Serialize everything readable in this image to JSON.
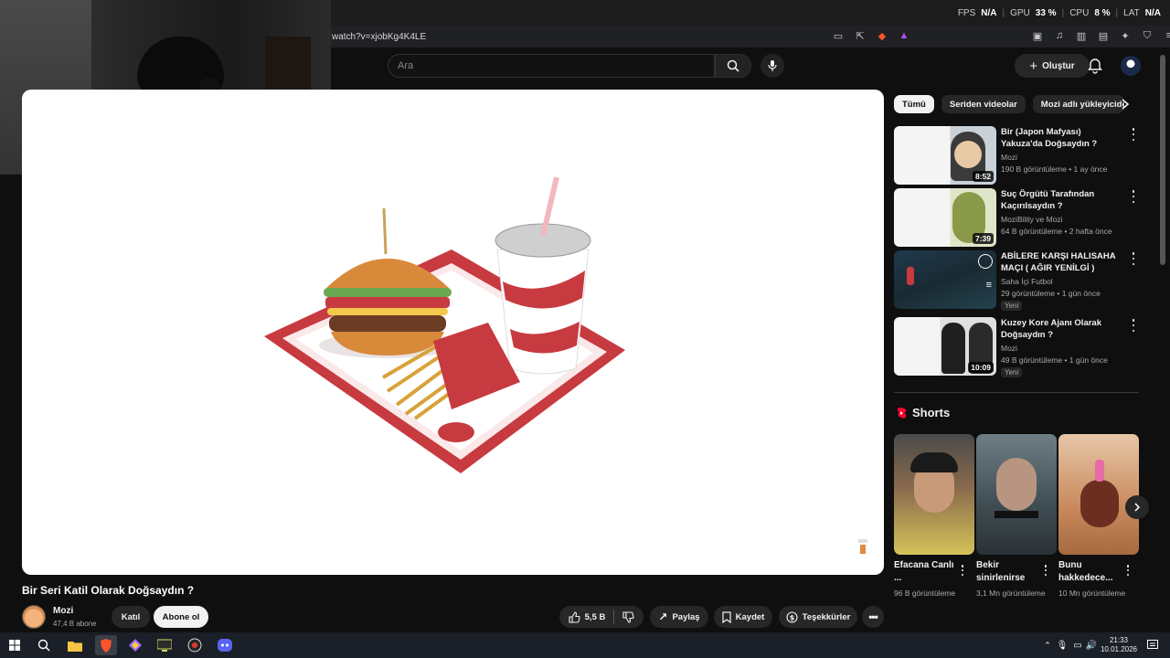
{
  "overlay": {
    "fps_label": "FPS",
    "fps_value": "N/A",
    "gpu_label": "GPU",
    "gpu_value": "33 %",
    "cpu_label": "CPU",
    "cpu_value": "8 %",
    "lat_label": "LAT",
    "lat_value": "N/A"
  },
  "browser": {
    "url": "watch?v=xjobKg4K4LE"
  },
  "header": {
    "search_placeholder": "Ara",
    "create_label": "Oluştur"
  },
  "video": {
    "title": "Bir Seri Katil Olarak Doğsaydın ?",
    "channel": "Mozi",
    "subscribers": "47,4 B abone",
    "join_label": "Katıl",
    "subscribe_label": "Abone ol",
    "likes": "5,5 B",
    "share_label": "Paylaş",
    "save_label": "Kaydet",
    "thanks_label": "Teşekkürler"
  },
  "chips": [
    "Tümü",
    "Seriden videolar",
    "Mozi adlı yükleyiciden"
  ],
  "recommendations": [
    {
      "title": "Bir (Japon Mafyası) Yakuza'da Doğsaydın ?",
      "channel": "Mozi",
      "meta": "190 B görüntüleme • 1 ay önce",
      "duration": "8:52",
      "badge": ""
    },
    {
      "title": "Suç Örgütü Tarafından Kaçırılsaydın ?",
      "channel": "MoziBility ve Mozi",
      "meta": "64 B görüntüleme • 2 hafta önce",
      "duration": "7:39",
      "badge": ""
    },
    {
      "title": "ABİLERE KARŞI HALISAHA MAÇI ( AĞIR YENİLGİ )",
      "channel": "Saha İçi Futbol",
      "meta": "29 görüntüleme • 1 gün önce",
      "duration": "",
      "badge": "Yeni"
    },
    {
      "title": "Kuzey Kore Ajanı Olarak Doğsaydın ?",
      "channel": "Mozi",
      "meta": "49 B görüntüleme • 1 gün önce",
      "duration": "10:09",
      "badge": "Yeni"
    }
  ],
  "shorts": {
    "heading": "Shorts",
    "items": [
      {
        "title": "Efacana Canlı ...",
        "views": "96 B görüntüleme"
      },
      {
        "title": "Bekir sinirlenirse",
        "views": "3,1 Mn görüntüleme"
      },
      {
        "title": "Bunu hakkedece...",
        "views": "10 Mn görüntüleme"
      }
    ]
  },
  "taskbar": {
    "time": "21:33",
    "date": "10.01.2026"
  },
  "colors": {
    "accent": "#ff0033",
    "background": "#0f0f0f",
    "chip": "#272727"
  }
}
